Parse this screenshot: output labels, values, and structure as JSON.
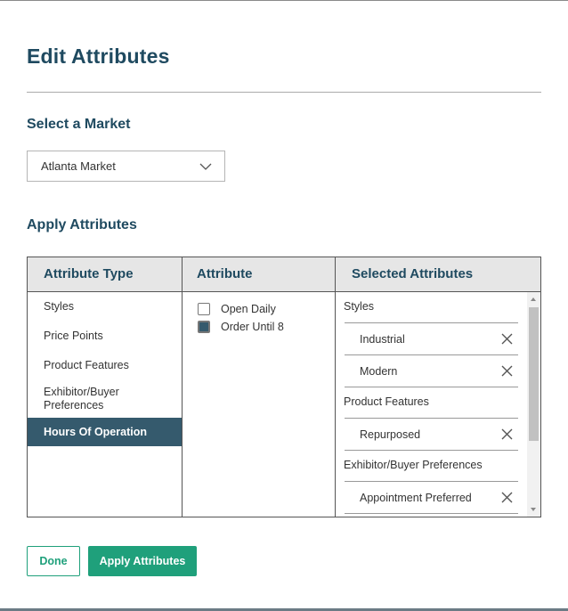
{
  "dialog": {
    "title": "Edit Attributes",
    "market_section_title": "Select a Market",
    "market_selected": "Atlanta Market",
    "apply_section_title": "Apply Attributes"
  },
  "table": {
    "headers": [
      "Attribute Type",
      "Attribute",
      "Selected Attributes"
    ],
    "attribute_types": [
      {
        "label": "Styles",
        "active": false
      },
      {
        "label": "Price Points",
        "active": false
      },
      {
        "label": "Product Features",
        "active": false
      },
      {
        "label": "Exhibitor/Buyer Preferences",
        "active": false
      },
      {
        "label": "Hours Of Operation",
        "active": true
      }
    ],
    "attributes": [
      {
        "label": "Open Daily",
        "checked": false
      },
      {
        "label": "Order Until 8",
        "checked": true
      }
    ],
    "selected": [
      {
        "group": "Styles",
        "items": [
          "Industrial",
          "Modern"
        ]
      },
      {
        "group": "Product Features",
        "items": [
          "Repurposed"
        ]
      },
      {
        "group": "Exhibitor/Buyer Preferences",
        "items": [
          "Appointment Preferred"
        ]
      }
    ]
  },
  "buttons": {
    "done": "Done",
    "apply": "Apply Attributes"
  },
  "colors": {
    "title": "#1f4a60",
    "active_row": "#355a6d",
    "primary": "#1fa07b"
  }
}
